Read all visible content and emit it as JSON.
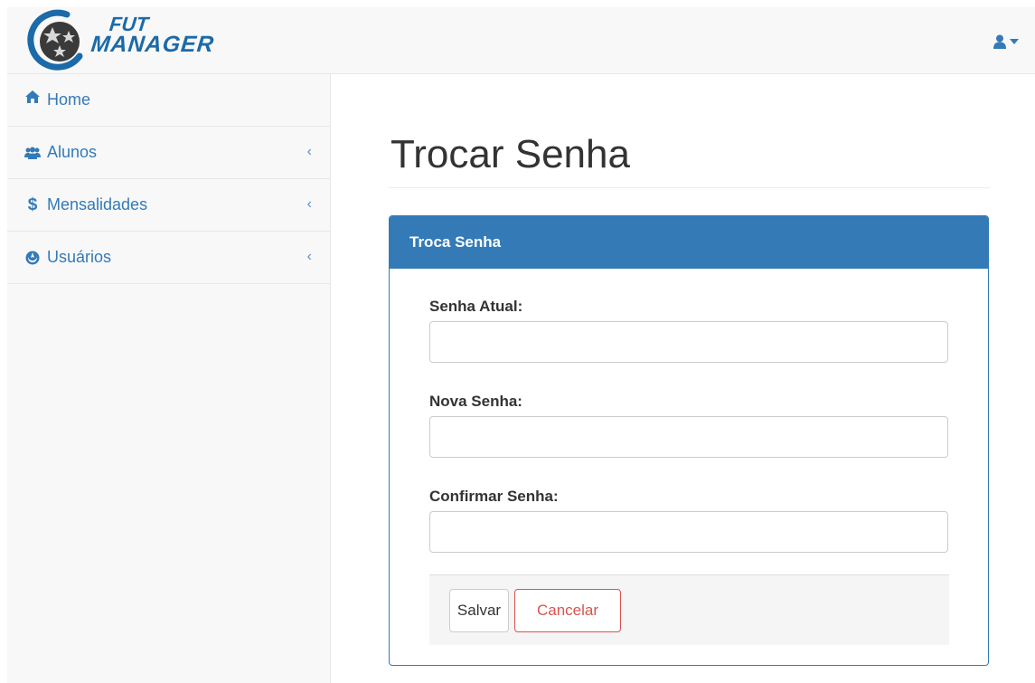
{
  "brand": {
    "line1": "FUT",
    "line2": "MANAGER",
    "logo_color": "#1c6aa8"
  },
  "navbar": {
    "user_icon": "user-icon",
    "caret_icon": "caret-down-icon"
  },
  "sidebar": {
    "items": [
      {
        "label": "Home",
        "icon": "home-icon"
      },
      {
        "label": "Alunos",
        "icon": "users-icon",
        "chevron": "‹"
      },
      {
        "label": "Mensalidades",
        "icon": "dollar-icon",
        "chevron": "‹"
      },
      {
        "label": "Usuários",
        "icon": "rebel-icon",
        "chevron": "‹"
      }
    ]
  },
  "page": {
    "title": "Trocar Senha"
  },
  "panel": {
    "heading": "Troca Senha",
    "fields": [
      {
        "label": "Senha Atual:",
        "value": ""
      },
      {
        "label": "Nova Senha:",
        "value": ""
      },
      {
        "label": "Confirmar Senha:",
        "value": ""
      }
    ],
    "buttons": {
      "save": "Salvar",
      "cancel": "Cancelar"
    }
  },
  "colors": {
    "primary": "#337ab7",
    "danger": "#d9534f"
  }
}
